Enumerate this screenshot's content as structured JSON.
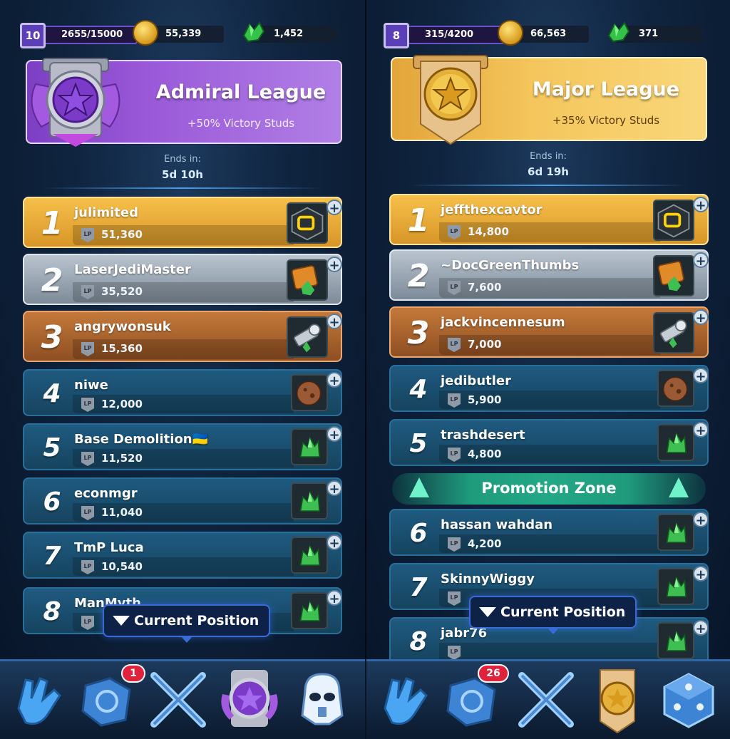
{
  "left": {
    "level": "10",
    "xp": "2655/15000",
    "coins": "55,339",
    "gems": "1,452",
    "league_title": "Admiral League",
    "league_bonus": "+50% Victory Studs",
    "ends_label": "Ends in:",
    "ends_value": "5d 10h",
    "rows": [
      {
        "rank": "1",
        "name": "julimited",
        "points": "51,360",
        "reward": "cube-icon"
      },
      {
        "rank": "2",
        "name": "LaserJediMaster",
        "points": "35,520",
        "reward": "crate-icon"
      },
      {
        "rank": "3",
        "name": "angrywonsuk",
        "points": "15,360",
        "reward": "part-icon"
      },
      {
        "rank": "4",
        "name": "niwe",
        "points": "12,000",
        "reward": "rock-icon"
      },
      {
        "rank": "5",
        "name": "Base Demolition🇺🇦",
        "points": "11,520",
        "reward": "crystal-icon"
      },
      {
        "rank": "6",
        "name": "econmgr",
        "points": "11,040",
        "reward": "crystal-icon"
      },
      {
        "rank": "7",
        "name": "TmP Luca",
        "points": "10,540",
        "reward": "crystal-icon"
      },
      {
        "rank": "8",
        "name": "ManMyth",
        "points": "",
        "reward": "crystal-icon"
      }
    ],
    "current_position": "Current Position",
    "nav_badge": "1"
  },
  "right": {
    "level": "8",
    "xp": "315/4200",
    "coins": "66,563",
    "gems": "371",
    "league_title": "Major League",
    "league_bonus": "+35% Victory Studs",
    "ends_label": "Ends in:",
    "ends_value": "6d 19h",
    "rows": [
      {
        "rank": "1",
        "name": "jeffthexcavtor",
        "points": "14,800",
        "reward": "cube-icon"
      },
      {
        "rank": "2",
        "name": "~DocGreenThumbs",
        "points": "7,600",
        "reward": "crate-icon"
      },
      {
        "rank": "3",
        "name": "jackvincennesum",
        "points": "7,000",
        "reward": "part-icon"
      },
      {
        "rank": "4",
        "name": "jedibutler",
        "points": "5,900",
        "reward": "rock-icon"
      },
      {
        "rank": "5",
        "name": "trashdesert",
        "points": "4,800",
        "reward": "crystal-icon"
      },
      {
        "rank": "6",
        "name": "hassan wahdan",
        "points": "4,200",
        "reward": "crystal-icon"
      },
      {
        "rank": "7",
        "name": "SkinnyWiggy",
        "points": "",
        "reward": "crystal-icon"
      },
      {
        "rank": "8",
        "name": "jabr76",
        "points": "",
        "reward": "crystal-icon"
      }
    ],
    "promotion_zone": "Promotion Zone",
    "current_position": "Current Position",
    "nav_badge": "26"
  },
  "lp_icon_text": "LP",
  "colors": {
    "gold": "#f6c04a",
    "silver": "#b9c4cf",
    "bronze": "#c4793a",
    "default_row": "#1f5a80",
    "promo": "#23a886",
    "admiral": "#9b5ad9"
  }
}
